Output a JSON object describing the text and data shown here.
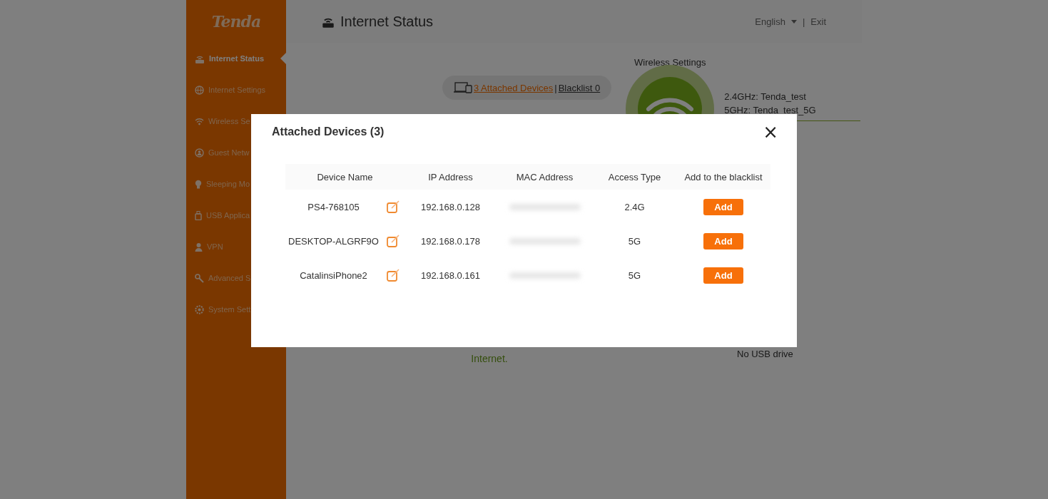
{
  "sidebar": {
    "logo": "Tenda",
    "items": [
      {
        "label": "Internet Status",
        "selected": true
      },
      {
        "label": "Internet Settings",
        "selected": false
      },
      {
        "label": "Wireless Se",
        "selected": false
      },
      {
        "label": "Guest Netw",
        "selected": false
      },
      {
        "label": "Sleeping Mo",
        "selected": false
      },
      {
        "label": "USB Applica",
        "selected": false
      },
      {
        "label": "VPN",
        "selected": false
      },
      {
        "label": "Advanced S",
        "selected": false
      },
      {
        "label": "System Sett",
        "selected": false
      }
    ]
  },
  "header": {
    "title": "Internet Status",
    "language": "English",
    "separator": "|",
    "exit": "Exit"
  },
  "status": {
    "attached_link": "3 Attached Devices ",
    "separator": "|",
    "blacklist_link": "Blacklist 0",
    "wireless_title": "Wireless Settings",
    "ssids": [
      "2.4GHz: Tenda_test",
      "5GHz: Tenda_test_5G"
    ],
    "connection_text": "Internet.",
    "usb_text": "No USB drive"
  },
  "modal": {
    "title": "Attached Devices (3)",
    "close": "×",
    "columns": [
      "Device Name",
      "IP Address",
      "MAC Address",
      "Access Type",
      "Add to the blacklist"
    ],
    "rows": [
      {
        "name": "PS4-768105",
        "ip": "192.168.0.128",
        "mac_blurred": true,
        "access": "2.4G",
        "action": "Add"
      },
      {
        "name": "DESKTOP-ALGRF9O",
        "ip": "192.168.0.178",
        "mac_blurred": true,
        "access": "5G",
        "action": "Add"
      },
      {
        "name": "CatalinsiPhone2",
        "ip": "192.168.0.161",
        "mac_blurred": true,
        "access": "5G",
        "action": "Add"
      }
    ]
  }
}
